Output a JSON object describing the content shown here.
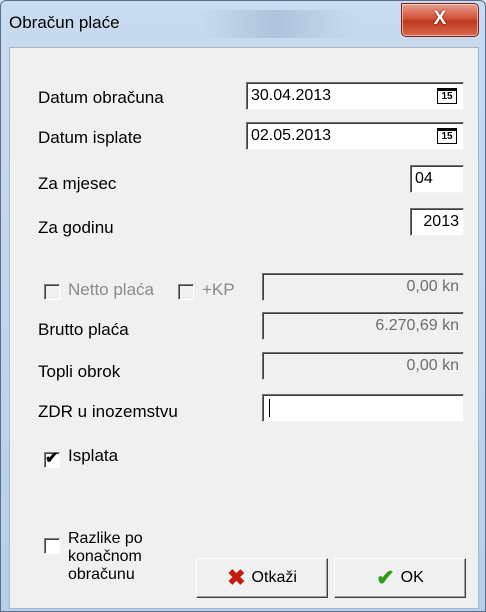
{
  "window": {
    "title": "Obračun plaće",
    "close_glyph": "X"
  },
  "fields": {
    "datum_obracuna": {
      "label": "Datum obračuna",
      "value": "30.04.2013",
      "cal_icon": "15"
    },
    "datum_isplate": {
      "label": "Datum isplate",
      "value": "02.05.2013",
      "cal_icon": "15"
    },
    "za_mjesec": {
      "label": "Za mjesec",
      "value": "04"
    },
    "za_godinu": {
      "label": "Za godinu",
      "value": "2013"
    },
    "netto": {
      "label": "Netto plaća",
      "kp_label": "+KP",
      "value": "0,00 kn",
      "checked": false,
      "enabled": false
    },
    "brutto": {
      "label": "Brutto plaća",
      "value": "6.270,69 kn"
    },
    "topli_obrok": {
      "label": "Topli obrok",
      "value": "0,00 kn"
    },
    "zdr": {
      "label": "ZDR u inozemstvu",
      "value": ""
    },
    "isplata": {
      "label": "Isplata",
      "checked": true,
      "mark": "✔"
    },
    "razlike": {
      "label_line1": "Razlike po",
      "label_line2": "konačnom",
      "label_line3": "obračunu",
      "checked": false
    }
  },
  "buttons": {
    "cancel": {
      "label": "Otkaži",
      "icon": "✖"
    },
    "ok": {
      "label": "OK",
      "icon": "✔"
    }
  }
}
